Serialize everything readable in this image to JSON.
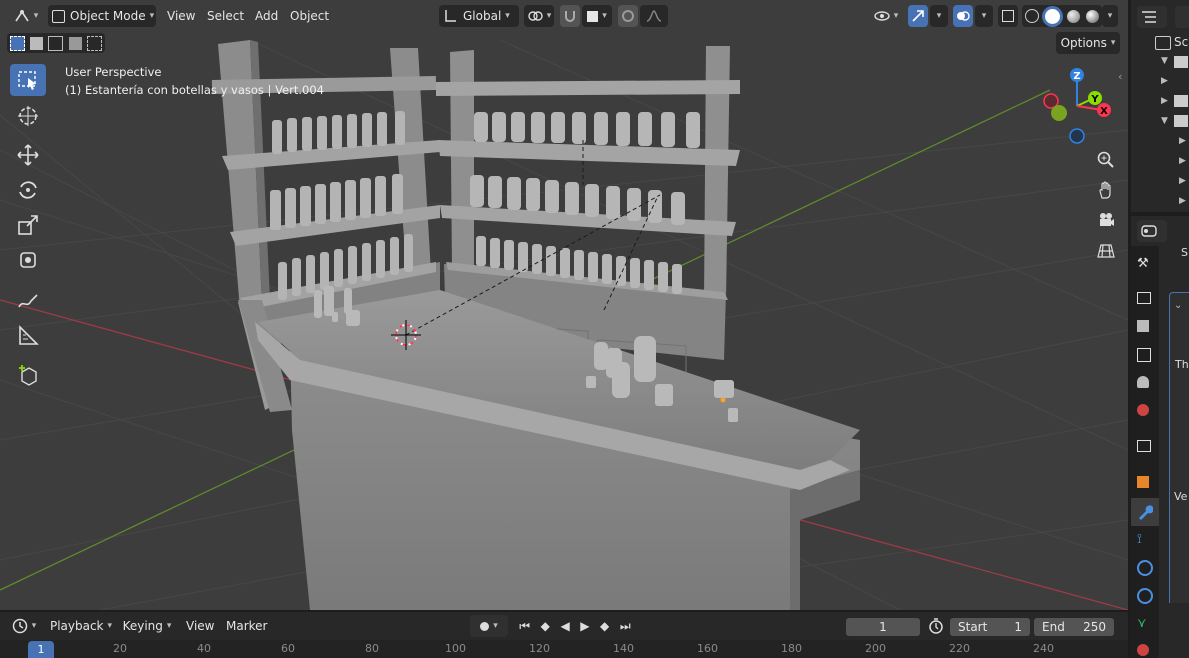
{
  "header": {
    "editor_type_icon": "viewport-editor-icon",
    "mode": "Object Mode",
    "menus": [
      "View",
      "Select",
      "Add",
      "Object"
    ],
    "transform_orientation": "Global"
  },
  "viewport": {
    "perspective_label": "User Perspective",
    "selection_label": "(1) Estantería con botellas y vasos | Vert.004",
    "options_label": "Options",
    "gizmo": {
      "z": "Z",
      "y": "Y",
      "x": "X"
    }
  },
  "timeline": {
    "menus": [
      "Playback",
      "Keying",
      "View",
      "Marker"
    ],
    "current_frame": "1",
    "start_label": "Start",
    "start_value": "1",
    "end_label": "End",
    "end_value": "250",
    "ruler_current": "1",
    "ruler_ticks": [
      "20",
      "40",
      "60",
      "80",
      "100",
      "120",
      "140",
      "160",
      "180",
      "200",
      "220",
      "240"
    ]
  },
  "outliner": {
    "header_label": "Sc"
  },
  "properties": {
    "label_th": "Th",
    "label_ve": "Ve"
  },
  "colors": {
    "accent": "#4772b3",
    "x_axis": "#ff3352",
    "y_axis": "#8bdc00",
    "z_axis": "#2f83e3"
  }
}
